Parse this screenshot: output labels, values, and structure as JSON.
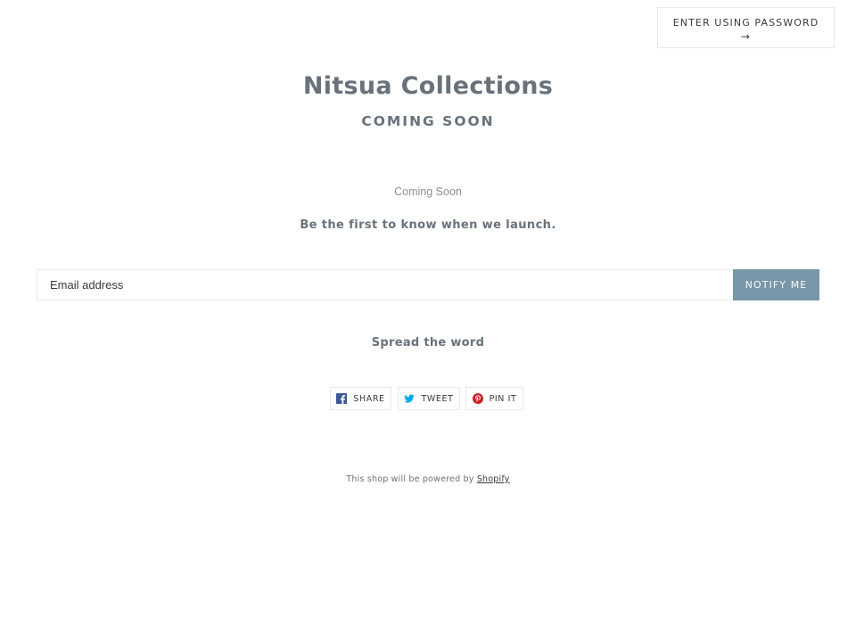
{
  "header": {
    "password_button_label": "ENTER USING PASSWORD",
    "password_button_arrow": "→"
  },
  "hero": {
    "shop_title": "Nitsua Collections",
    "subtitle": "COMING SOON"
  },
  "content": {
    "message": "Coming Soon",
    "tagline": "Be the first to know when we launch."
  },
  "signup": {
    "email_placeholder": "Email address",
    "email_value": "",
    "submit_label": "NOTIFY ME"
  },
  "social": {
    "heading": "Spread the word",
    "buttons": [
      {
        "label": "SHARE",
        "icon": "facebook-icon",
        "color": "#3b5998"
      },
      {
        "label": "TWEET",
        "icon": "twitter-icon",
        "color": "#00aced"
      },
      {
        "label": "PIN IT",
        "icon": "pinterest-icon",
        "color": "#cb2027"
      }
    ]
  },
  "footer": {
    "powered_by_text": "This shop will be powered by",
    "shopify_link": "Shopify"
  },
  "colors": {
    "accent": "#7796a8",
    "text": "#69727b",
    "border": "#e8e9eb"
  }
}
